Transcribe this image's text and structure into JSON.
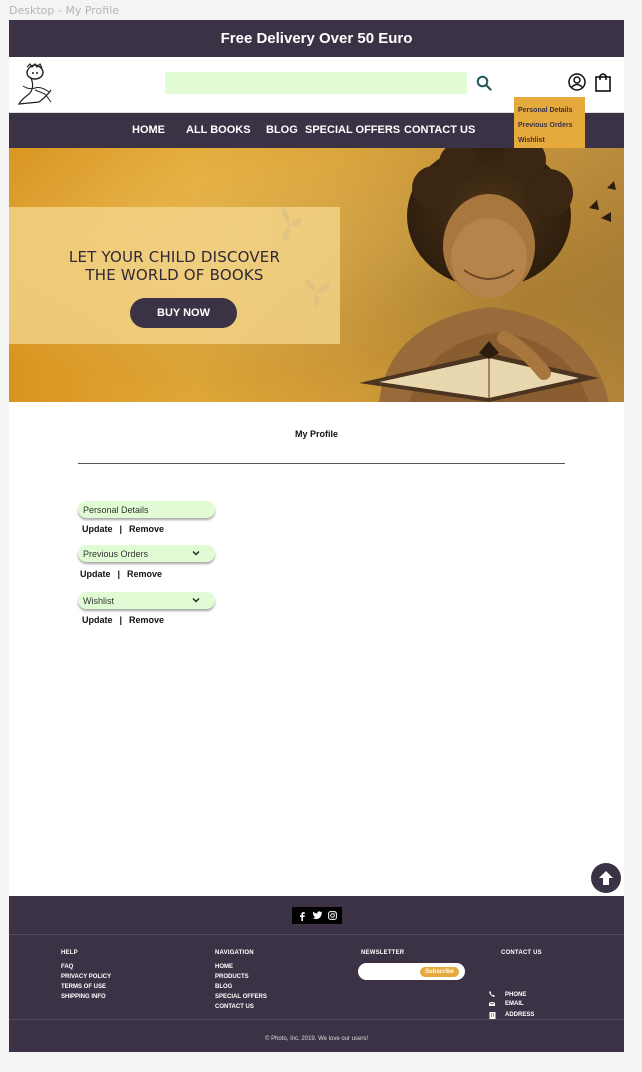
{
  "frame_label": "Desktop - My Profile",
  "promo": {
    "text": "Free Delivery Over 50 Euro"
  },
  "header": {
    "search_placeholder": "",
    "icons": [
      "search-icon",
      "user-icon",
      "shopping-bag-icon"
    ]
  },
  "nav": {
    "items": [
      "HOME",
      "ALL BOOKS",
      "BLOG",
      "SPECIAL OFFERS",
      "CONTACT US"
    ]
  },
  "account_menu": {
    "items": [
      "Personal Details",
      "Previous Orders",
      "Wishlist"
    ]
  },
  "hero": {
    "line1": "LET YOUR CHILD DISCOVER",
    "line2": "THE WORLD OF BOOKS",
    "cta": "BUY NOW"
  },
  "profile": {
    "title": "My Profile",
    "sections": [
      {
        "label": "Personal Details",
        "actions": [
          "Update",
          "Remove"
        ]
      },
      {
        "label": "Previous Orders",
        "actions": [
          "Update",
          "Remove"
        ]
      },
      {
        "label": "Wishlist",
        "actions": [
          "Update",
          "Remove"
        ]
      }
    ]
  },
  "footer": {
    "social": [
      "facebook-icon",
      "twitter-icon",
      "instagram-icon"
    ],
    "help": {
      "heading": "HELP",
      "links": [
        "FAQ",
        "PRIVACY POLICY",
        "TERMS OF USE",
        "SHIPPING INFO"
      ]
    },
    "navigation": {
      "heading": "NAVIGATION",
      "links": [
        "HOME",
        "PRODUCTS",
        "BLOG",
        "SPECIAL OFFERS",
        "CONTACT US"
      ]
    },
    "newsletter": {
      "heading": "NEWSLETTER",
      "placeholder": "",
      "button": "Subscribe"
    },
    "contact": {
      "heading": "CONTACT US",
      "items": [
        "PHONE",
        "EMAIL",
        "ADDRESS"
      ]
    },
    "copyright": "© Photo, Inc. 2019. We love our users!"
  },
  "colors": {
    "primary": "#3c3246",
    "accent": "#e6a93b",
    "input_bg": "#e1fcd4"
  }
}
